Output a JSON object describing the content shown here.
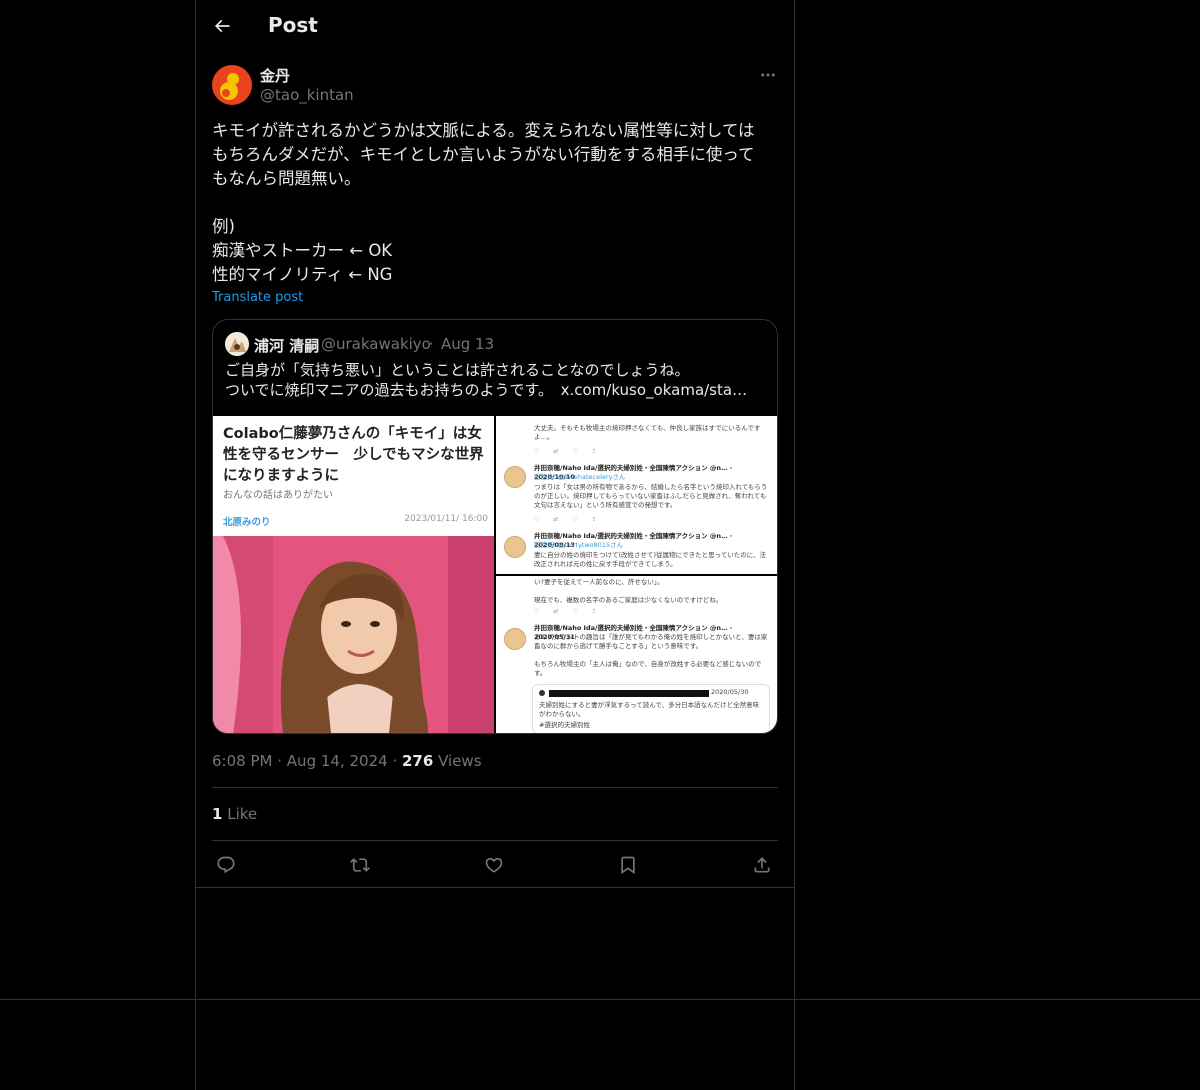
{
  "header": {
    "title": "Post"
  },
  "author": {
    "name": "金丹",
    "handle": "@tao_kintan"
  },
  "tweet": {
    "text": "キモイが許されるかどうかは文脈による。変えられない属性等に対しては\nもちろんダメだが、キモイとしか言いようがない行動をする相手に使って\nもなんら問題無い。\n\n例)\n痴漢やストーカー ← OK\n性的マイノリティ ← NG",
    "translate_label": "Translate post"
  },
  "quote": {
    "name": "浦河 清嗣",
    "handle": "@urakawakiyo",
    "separator": "·",
    "date": "Aug 13",
    "text_line1": "ご自身が「気持ち悪い」ということは許されることなのでしょうね。",
    "text_line2": "ついでに焼印マニアの過去もお持ちのようです。",
    "link": "x.com/kuso_okama/sta…",
    "article": {
      "title": "Colabo仁藤夢乃さんの「キモイ」は女性を守るセンサー　少しでもマシな世界になりますように",
      "subtitle": "おんなの話はありがたい",
      "author": "北原みのり",
      "date": "2023/01/11/ 16:00"
    },
    "screenshot1": {
      "line0": "大丈夫。そもそも牧場主の焼印押さなくても、仲良し家族はすでにいるんですよ…。",
      "name1": "井田奈穂/Naho Ida/選択的夫婦別姓・全国陳情アクション @n… · 2020/10/10",
      "reply1": "返信先: @lovehateceleryさん",
      "body1": "つまりは「女は男の所有物であるから、結婚したら名字という焼印入れてもらうのが正しい。焼印押してもらっていない家畜はふしだらと見做され、奪われても文句は言えない」という所有感覚での発想です。",
      "name2": "井田奈穂/Naho Ida/選択的夫婦別姓・全国陳情アクション @n… · 2020/08/13",
      "reply2": "返信先: @thirtytwo8015さん",
      "body2": "妻に自分の姓の焼印をつけて(改姓させて)従属物にできたと思っていたのに、法改正されれば元の姓に戻す手段ができてしまう。"
    },
    "screenshot2": {
      "line0": "い?妻子を従えて一人前なのに、許せない」。",
      "line1": "現在でも、複数の名字のあるご家庭は少なくないのですけどね。",
      "name1": "井田奈穂/Naho Ida/選択的夫婦別姓・全国陳情アクション @n… · 2020/05/31",
      "body1": "あのアカウントの趣旨は「誰が見てもわかる俺の姓を焼印しとかないと、妻は家畜なのに群から逃げて勝手なことする」という意味です。",
      "body2": "もちろん牧場主の「主人は俺」なので、自身が改姓する必要など感じないのです。",
      "inner_date": "2020/05/30",
      "inner_body": "夫婦別姓にすると妻が浮気するって読んで、多分日本語なんだけど全然意味がわからない。",
      "inner_tag": "#選択的夫婦別姓"
    }
  },
  "meta": {
    "time": "6:08 PM",
    "dot": "·",
    "date": "Aug 14, 2024",
    "views_count": "276",
    "views_label": "Views"
  },
  "likes": {
    "count": "1",
    "label": "Like"
  },
  "icons": {
    "back": "arrow-left-icon",
    "more": "more-horizontal-icon",
    "reply": "reply-icon",
    "repost": "repost-icon",
    "like": "heart-icon",
    "bookmark": "bookmark-icon",
    "share": "share-icon"
  },
  "colors": {
    "background": "#000000",
    "link": "#1d9bf0",
    "muted": "#71767b",
    "text": "#e7e9ea",
    "border": "#2f3336"
  }
}
